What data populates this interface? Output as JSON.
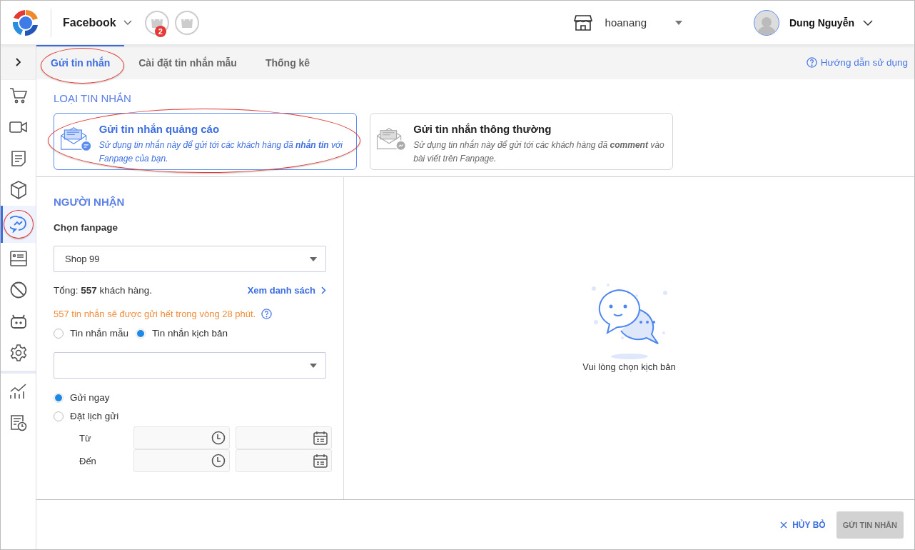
{
  "header": {
    "channel": "Facebook",
    "order_badge": "2",
    "store": "hoanang",
    "user": "Dung Nguyễn"
  },
  "sidebar": {
    "items": [
      {
        "kind": "cart",
        "selected": false,
        "circled": false
      },
      {
        "kind": "video",
        "selected": false,
        "circled": false
      },
      {
        "kind": "document",
        "selected": false,
        "circled": false
      },
      {
        "kind": "box",
        "selected": false,
        "circled": false
      },
      {
        "kind": "chat",
        "selected": true,
        "circled": true
      },
      {
        "kind": "card",
        "selected": false,
        "circled": false
      },
      {
        "kind": "ban",
        "selected": false,
        "circled": false
      },
      {
        "kind": "robot",
        "selected": false,
        "circled": false
      },
      {
        "kind": "gear",
        "selected": false,
        "circled": false
      },
      {
        "kind": "chart",
        "selected": false,
        "circled": false
      },
      {
        "kind": "report",
        "selected": false,
        "circled": false
      }
    ]
  },
  "tabs": [
    {
      "label": "Gửi tin nhắn",
      "selected": true,
      "circled": true
    },
    {
      "label": "Cài đặt tin nhắn mẫu",
      "selected": false,
      "circled": false
    },
    {
      "label": "Thống kê",
      "selected": false,
      "circled": false
    }
  ],
  "help_link": "Hướng dẫn sử dụng",
  "message_type": {
    "title": "LOẠI TIN NHẮN",
    "options": [
      {
        "kind": "ad",
        "title": "Gửi tin nhắn quảng cáo",
        "description": "Sử dụng tin nhắn này để gửi tới các khách hàng đã **nhắn tin** với Fanpage của bạn.",
        "selected": true,
        "circled": true
      },
      {
        "kind": "normal",
        "title": "Gửi tin nhắn thông thường",
        "description": "Sử dụng tin nhắn này để gửi tới các khách hàng đã **comment** vào bài viết trên Fanpage.",
        "selected": false,
        "circled": false
      }
    ]
  },
  "recipients": {
    "title": "NGƯỜI NHẬN",
    "fanpage_label": "Chọn fanpage",
    "fanpage_value": "Shop 99",
    "total": "Tổng: **557** khách hàng.",
    "view_list": "Xem danh sách",
    "notice": "557 tin nhắn sẽ được gửi hết trong vòng 28 phút.",
    "message_source": [
      {
        "label": "Tin nhắn mẫu",
        "selected": false
      },
      {
        "label": "Tin nhắn kịch bản",
        "selected": true
      }
    ],
    "send_time": [
      {
        "label": "Gửi ngay",
        "selected": true
      },
      {
        "label": "Đặt lịch gửi",
        "selected": false
      }
    ],
    "schedule_labels": [
      "Từ",
      "Đến"
    ]
  },
  "empty_state": {
    "text": "Vui lòng chọn kịch bản"
  },
  "footer": {
    "cancel": "HỦY BỎ",
    "submit": "GỬI TIN NHẮN",
    "submit_disabled": true
  }
}
